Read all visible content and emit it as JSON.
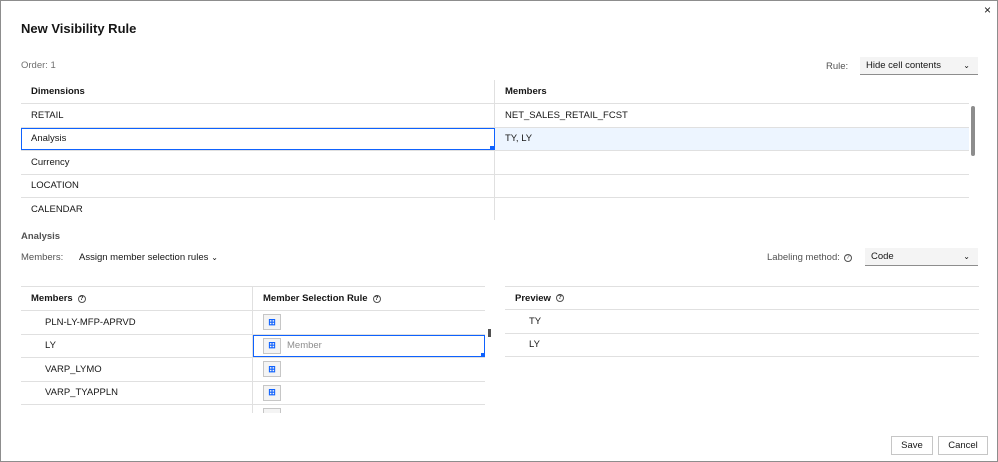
{
  "dialog": {
    "title": "New Visibility Rule",
    "close_symbol": "×",
    "order": "Order: 1",
    "rule_label": "Rule:",
    "rule_value": "Hide cell contents"
  },
  "dimensions_table": {
    "headers": [
      "Dimensions",
      "Members"
    ],
    "rows": [
      {
        "dimension": "RETAIL",
        "members": "NET_SALES_RETAIL_FCST"
      },
      {
        "dimension": "Analysis",
        "members": "TY, LY"
      },
      {
        "dimension": "Currency",
        "members": ""
      },
      {
        "dimension": "LOCATION",
        "members": ""
      },
      {
        "dimension": "CALENDAR",
        "members": ""
      }
    ]
  },
  "analysis": {
    "section_title": "Analysis",
    "members_label": "Members:",
    "members_mode": "Assign member selection rules",
    "labeling_label": "Labeling method:",
    "labeling_value": "Code",
    "help_symbol": "?"
  },
  "members_table": {
    "headers": [
      "Members",
      "Member Selection Rule"
    ],
    "rows": [
      {
        "member": "PLN-LY-MFP-APRVD",
        "rule": ""
      },
      {
        "member": "LY",
        "rule": "Member"
      },
      {
        "member": "VARP_LYMO",
        "rule": ""
      },
      {
        "member": "VARP_TYAPPLN",
        "rule": ""
      }
    ],
    "rule_icon_symbol": "⊞"
  },
  "preview": {
    "header": "Preview",
    "rows": [
      "TY",
      "LY"
    ]
  },
  "buttons": {
    "save": "Save",
    "cancel": "Cancel"
  },
  "colors": {
    "accent": "#0f62fe",
    "selected_row": "#edf5ff"
  }
}
